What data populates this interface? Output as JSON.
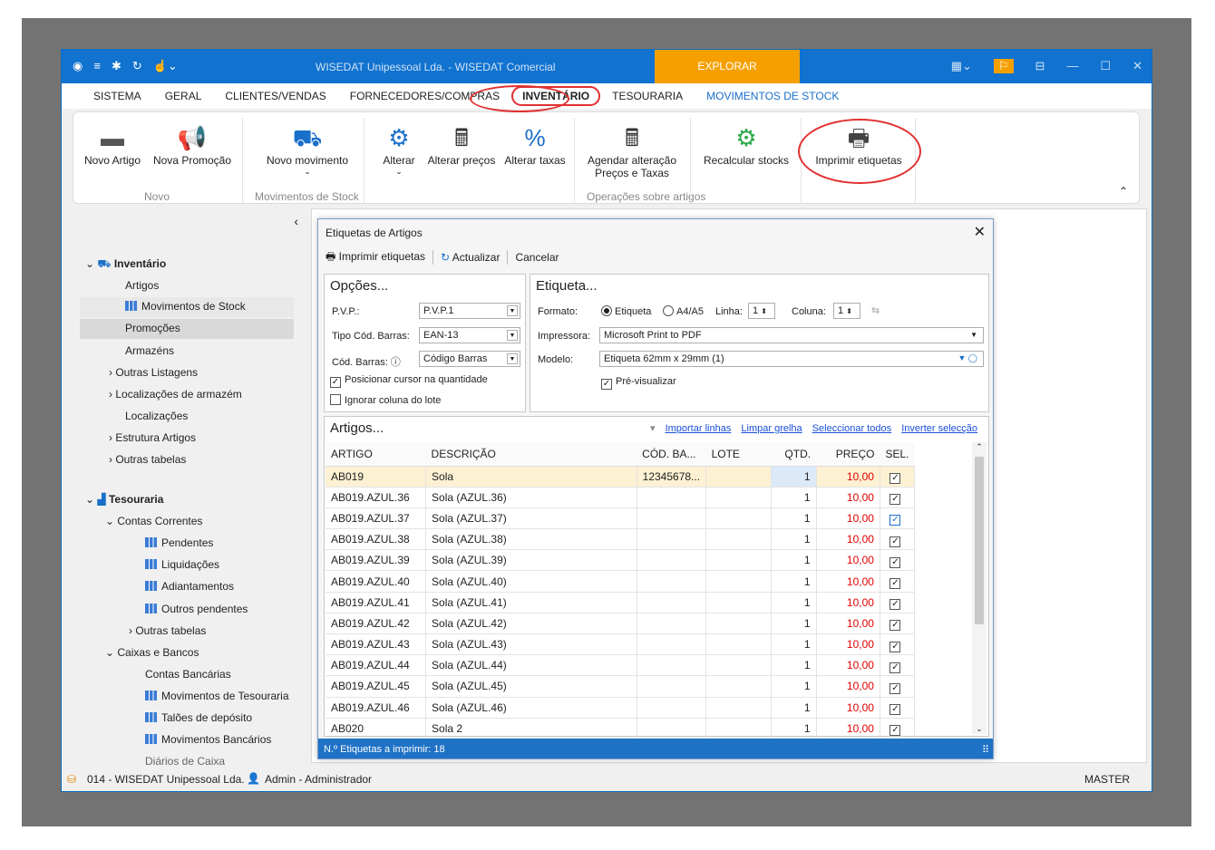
{
  "titlebar": {
    "title": "WISEDAT Unipessoal Lda. - WISEDAT Comercial",
    "explorar": "EXPLORAR"
  },
  "menu": [
    "SISTEMA",
    "GERAL",
    "CLIENTES/VENDAS",
    "FORNECEDORES/COMPRAS",
    "INVENTÁRIO",
    "TESOURARIA",
    "MOVIMENTOS DE STOCK"
  ],
  "ribbon": {
    "novo_artigo": "Novo Artigo",
    "nova_promocao": "Nova Promoção",
    "grp_novo": "Novo",
    "novo_movimento": "Novo movimento",
    "grp_movimentos": "Movimentos de Stock",
    "alterar": "Alterar",
    "alterar_precos": "Alterar preços",
    "alterar_taxas": "Alterar taxas",
    "agendar_1": "Agendar alteração",
    "agendar_2": "Preços e Taxas",
    "recalcular": "Recalcular stocks",
    "grp_operacoes": "Operações sobre artigos",
    "imprimir": "Imprimir etiquetas"
  },
  "sidebar": {
    "inventario": "Inventário",
    "artigos": "Artigos",
    "movimentos": "Movimentos de Stock",
    "promocoes": "Promoções",
    "armazens": "Armazéns",
    "outras_listagens": "Outras Listagens",
    "localizacoes_arm": "Localizações de armazém",
    "localizacoes": "Localizações",
    "estrutura": "Estrutura Artigos",
    "outras_tabelas": "Outras tabelas",
    "tesouraria": "Tesouraria",
    "contas_correntes": "Contas Correntes",
    "pendentes": "Pendentes",
    "liquidacoes": "Liquidações",
    "adiantamentos": "Adiantamentos",
    "outros_pendentes": "Outros pendentes",
    "outras_tabelas2": "Outras tabelas",
    "caixas": "Caixas e Bancos",
    "contas_bancarias": "Contas Bancárias",
    "mov_tesouraria": "Movimentos de Tesouraria",
    "taloes": "Talões de depósito",
    "mov_bancarios": "Movimentos Bancários",
    "diarios": "Diários de Caixa"
  },
  "status": {
    "company": "014 - WISEDAT Unipessoal Lda.",
    "user": "Admin - Administrador",
    "mode": "MASTER"
  },
  "dialog": {
    "title": "Etiquetas de Artigos",
    "tb_imprimir": "Imprimir etiquetas",
    "tb_actualizar": "Actualizar",
    "tb_cancelar": "Cancelar",
    "opcoes": "Opções...",
    "pvp_label": "P.V.P.:",
    "pvp_value": "P.V.P.1",
    "tipo_label": "Tipo Cód. Barras:",
    "tipo_value": "EAN-13",
    "cod_label": "Cód. Barras: ⓘ",
    "cod_value": "Código Barras",
    "posicionar": "Posicionar cursor na quantidade",
    "ignorar": "Ignorar coluna do lote",
    "etiqueta": "Etiqueta...",
    "formato_label": "Formato:",
    "radio_etiqueta": "Etiqueta",
    "radio_a4": "A4/A5",
    "linha_label": "Linha:",
    "linha_value": "1",
    "coluna_label": "Coluna:",
    "coluna_value": "1",
    "impressora_label": "Impressora:",
    "impressora_value": "Microsoft Print to PDF",
    "modelo_label": "Modelo:",
    "modelo_value": "Etiqueta 62mm x 29mm (1)",
    "previsualizar": "Pré-visualizar",
    "artigos": "Artigos...",
    "link_importar": "Importar linhas",
    "link_limpar": "Limpar grelha",
    "link_selecionar": "Seleccionar todos",
    "link_inverter": "Inverter selecção",
    "columns": [
      "ARTIGO",
      "DESCRIÇÃO",
      "CÓD. BA...",
      "LOTE",
      "QTD.",
      "PREÇO",
      "SEL."
    ],
    "rows": [
      {
        "artigo": "AB019",
        "descricao": "Sola",
        "cod": "12345678...",
        "lote": "",
        "qtd": "1",
        "preco": "10,00"
      },
      {
        "artigo": "AB019.AZUL.36",
        "descricao": "Sola (AZUL.36)",
        "cod": "",
        "lote": "",
        "qtd": "1",
        "preco": "10,00"
      },
      {
        "artigo": "AB019.AZUL.37",
        "descricao": "Sola (AZUL.37)",
        "cod": "",
        "lote": "",
        "qtd": "1",
        "preco": "10,00"
      },
      {
        "artigo": "AB019.AZUL.38",
        "descricao": "Sola (AZUL.38)",
        "cod": "",
        "lote": "",
        "qtd": "1",
        "preco": "10,00"
      },
      {
        "artigo": "AB019.AZUL.39",
        "descricao": "Sola (AZUL.39)",
        "cod": "",
        "lote": "",
        "qtd": "1",
        "preco": "10,00"
      },
      {
        "artigo": "AB019.AZUL.40",
        "descricao": "Sola (AZUL.40)",
        "cod": "",
        "lote": "",
        "qtd": "1",
        "preco": "10,00"
      },
      {
        "artigo": "AB019.AZUL.41",
        "descricao": "Sola (AZUL.41)",
        "cod": "",
        "lote": "",
        "qtd": "1",
        "preco": "10,00"
      },
      {
        "artigo": "AB019.AZUL.42",
        "descricao": "Sola (AZUL.42)",
        "cod": "",
        "lote": "",
        "qtd": "1",
        "preco": "10,00"
      },
      {
        "artigo": "AB019.AZUL.43",
        "descricao": "Sola (AZUL.43)",
        "cod": "",
        "lote": "",
        "qtd": "1",
        "preco": "10,00"
      },
      {
        "artigo": "AB019.AZUL.44",
        "descricao": "Sola (AZUL.44)",
        "cod": "",
        "lote": "",
        "qtd": "1",
        "preco": "10,00"
      },
      {
        "artigo": "AB019.AZUL.45",
        "descricao": "Sola (AZUL.45)",
        "cod": "",
        "lote": "",
        "qtd": "1",
        "preco": "10,00"
      },
      {
        "artigo": "AB019.AZUL.46",
        "descricao": "Sola (AZUL.46)",
        "cod": "",
        "lote": "",
        "qtd": "1",
        "preco": "10,00"
      },
      {
        "artigo": "AB020",
        "descricao": "Sola 2",
        "cod": "",
        "lote": "",
        "qtd": "1",
        "preco": "10,00"
      }
    ],
    "footer": "N.º Etiquetas a imprimir: 18"
  }
}
